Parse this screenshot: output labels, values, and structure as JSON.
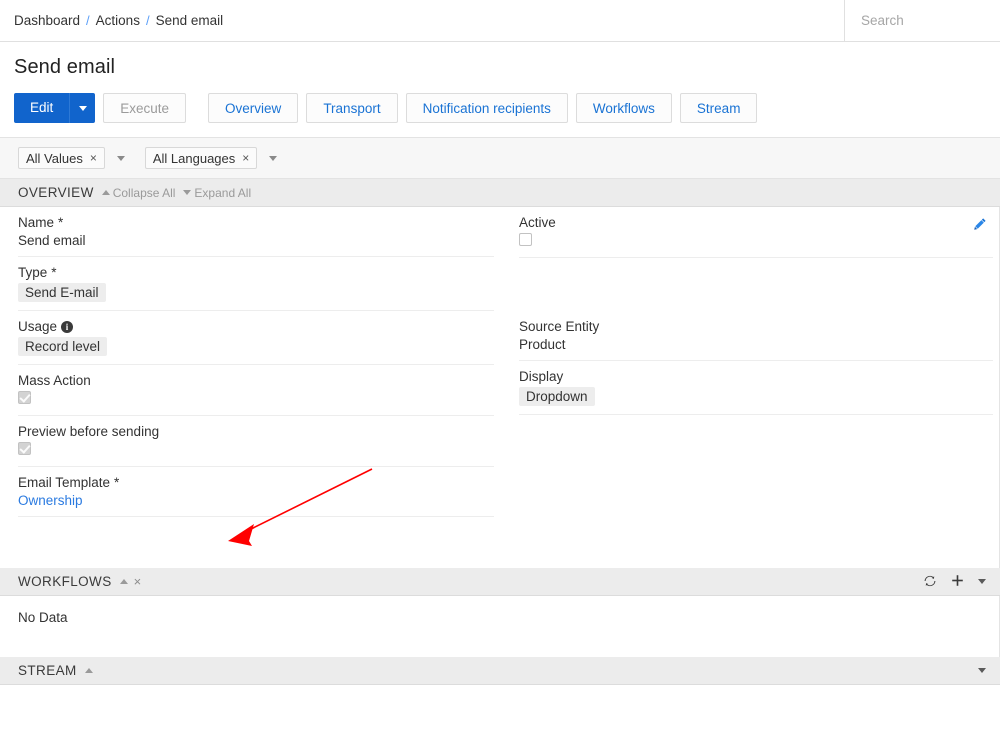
{
  "breadcrumb": {
    "items": [
      "Dashboard",
      "Actions",
      "Send email"
    ],
    "separator": "/"
  },
  "search": {
    "placeholder": "Search",
    "value": ""
  },
  "page": {
    "title": "Send email"
  },
  "toolbar": {
    "edit_label": "Edit",
    "edit_caret": "caret-down-icon",
    "execute_label": "Execute",
    "tabs": [
      {
        "label": "Overview"
      },
      {
        "label": "Transport"
      },
      {
        "label": "Notification recipients"
      },
      {
        "label": "Workflows"
      },
      {
        "label": "Stream"
      }
    ]
  },
  "filters": [
    {
      "label": "All Values",
      "remove": "×"
    },
    {
      "label": "All Languages",
      "remove": "×"
    }
  ],
  "sections": {
    "overview": {
      "title": "OVERVIEW",
      "collapse_all": "Collapse All",
      "expand_all": "Expand All",
      "left_fields": [
        {
          "label": "Name",
          "required": "*",
          "value": "Send email",
          "kind": "text"
        },
        {
          "label": "Type",
          "required": "*",
          "value": "Send E-mail",
          "kind": "badge"
        },
        {
          "label": "Usage",
          "required": "",
          "value": "Record level",
          "kind": "badge",
          "info": "info-icon"
        },
        {
          "label": "Mass Action",
          "required": "",
          "value": "",
          "kind": "checkbox-checked"
        },
        {
          "label": "Preview before sending",
          "required": "",
          "value": "",
          "kind": "checkbox-checked"
        },
        {
          "label": "Email Template",
          "required": "*",
          "value": "Ownership",
          "kind": "link"
        }
      ],
      "right_fields": [
        {
          "label": "Active",
          "required": "",
          "value": "",
          "kind": "checkbox"
        },
        {
          "label": "Source Entity",
          "required": "",
          "value": "Product",
          "kind": "text"
        },
        {
          "label": "Display",
          "required": "",
          "value": "Dropdown",
          "kind": "badge"
        }
      ],
      "edit_icon": "pencil-icon"
    },
    "workflows": {
      "title": "WORKFLOWS",
      "close": "×",
      "refresh_icon": "refresh-icon",
      "add_icon": "plus-icon",
      "more_icon": "caret-down-icon",
      "empty_text": "No Data"
    },
    "stream": {
      "title": "STREAM",
      "more_icon": "caret-down-icon"
    }
  },
  "annotation": {
    "color": "#ff0000",
    "type": "arrow"
  }
}
